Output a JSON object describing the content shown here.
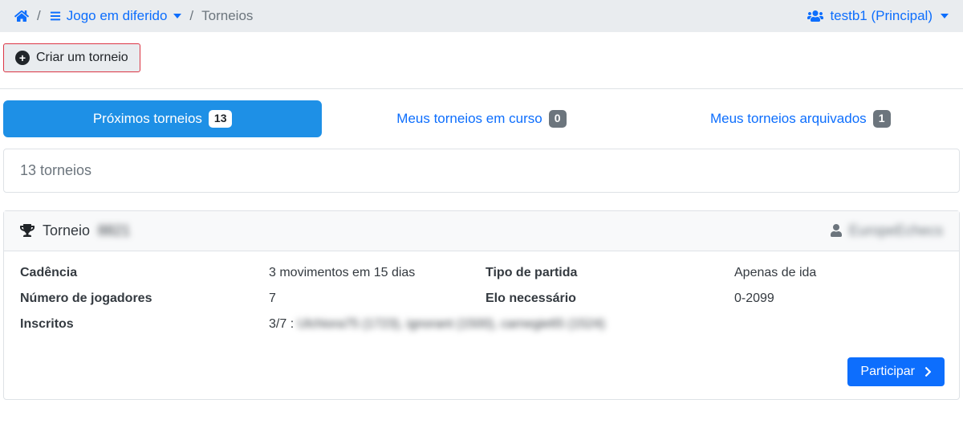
{
  "breadcrumb": {
    "dropdown_label": "Jogo em diferido",
    "current": "Torneios"
  },
  "user": {
    "label": "testb1 (Principal)"
  },
  "actions": {
    "create_label": "Criar um torneio"
  },
  "tabs": [
    {
      "label": "Próximos torneios",
      "count": "13",
      "active": true
    },
    {
      "label": "Meus torneios em curso",
      "count": "0",
      "active": false
    },
    {
      "label": "Meus torneios arquivados",
      "count": "1",
      "active": false
    }
  ],
  "summary": {
    "count_text": "13 torneios"
  },
  "tournament": {
    "title_prefix": "Torneio",
    "title_id": "8821",
    "owner": "EuropeEchecs",
    "fields": {
      "cadence_label": "Cadência",
      "cadence_value": "3 movimentos em 15 dias",
      "gametype_label": "Tipo de partida",
      "gametype_value": "Apenas de ida",
      "players_label": "Número de jogadores",
      "players_value": "7",
      "elo_label": "Elo necessário",
      "elo_value": "0-2099",
      "enrolled_label": "Inscritos",
      "enrolled_prefix": "3/7 : ",
      "enrolled_list": "Ulchiora75 (1723), ignorant (1500), carnegie65 (1524)"
    },
    "join_label": "Participar"
  }
}
